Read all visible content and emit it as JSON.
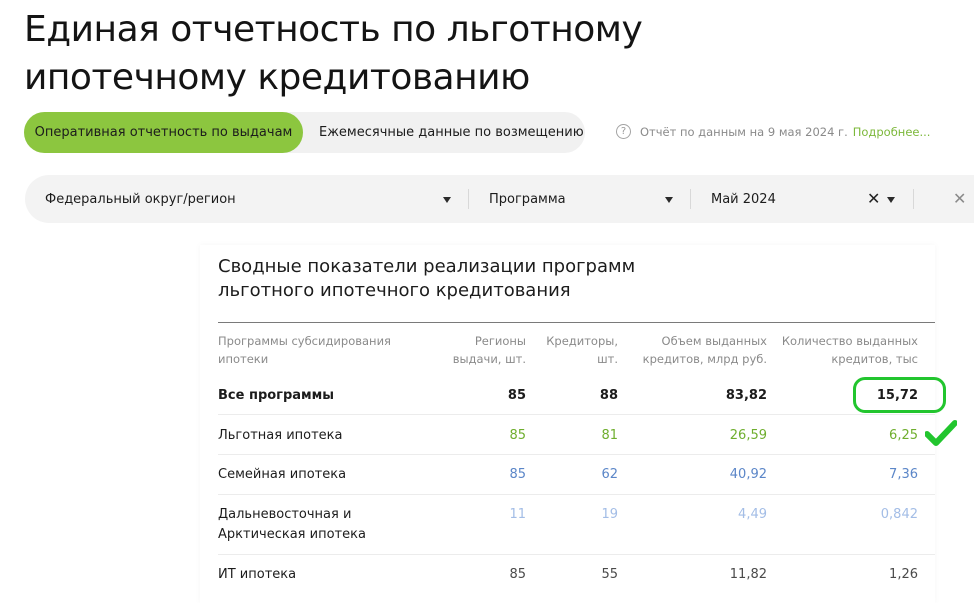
{
  "page": {
    "title_line1": "Единая отчетность по льготному",
    "title_line2": "ипотечному кредитованию"
  },
  "tabs": [
    {
      "label": "Оперативная отчетность по выдачам",
      "active": true
    },
    {
      "label": "Ежемесячные данные по возмещению",
      "active": false
    }
  ],
  "report_note": {
    "icon": "question-circle-icon",
    "text": "Отчёт по данным на 9 мая 2024 г.",
    "link": "Подробнее..."
  },
  "filters": {
    "region": {
      "value": "Федеральный округ/регион"
    },
    "program": {
      "value": "Программа"
    },
    "period": {
      "value": "Май 2024"
    }
  },
  "card": {
    "title_line1": "Сводные показатели реализации программ",
    "title_line2": "льготного ипотечного кредитования"
  },
  "table": {
    "headers": {
      "program": [
        "Программы субсидирования",
        "ипотеки"
      ],
      "regions": [
        "Регионы",
        "выдачи, шт."
      ],
      "creditors": [
        "Кредиторы,",
        "шт."
      ],
      "volume": [
        "Объем выданных",
        "кредитов, млрд руб."
      ],
      "count": [
        "Количество выданных",
        "кредитов, тыс"
      ]
    },
    "rows": [
      {
        "name": [
          "Все программы"
        ],
        "regions": "85",
        "creditors": "88",
        "volume": "83,82",
        "count": "15,72",
        "color": "#1c1c1c"
      },
      {
        "name": [
          "Льготная ипотека"
        ],
        "regions": "85",
        "creditors": "81",
        "volume": "26,59",
        "count": "6,25",
        "color": "#6fae2e"
      },
      {
        "name": [
          "Семейная ипотека"
        ],
        "regions": "85",
        "creditors": "62",
        "volume": "40,92",
        "count": "7,36",
        "color": "#5b86c8"
      },
      {
        "name": [
          "Дальневосточная и",
          "Арктическая ипотека"
        ],
        "regions": "11",
        "creditors": "19",
        "volume": "4,49",
        "count": "0,842",
        "color": "#a3bde6"
      },
      {
        "name": [
          "ИТ ипотека"
        ],
        "regions": "85",
        "creditors": "55",
        "volume": "11,82",
        "count": "1,26",
        "color": "#4a4a4a"
      }
    ]
  },
  "colors": {
    "accent_green": "#8cc63f",
    "highlight_green": "#22c52e",
    "link_green": "#7cb83a"
  }
}
